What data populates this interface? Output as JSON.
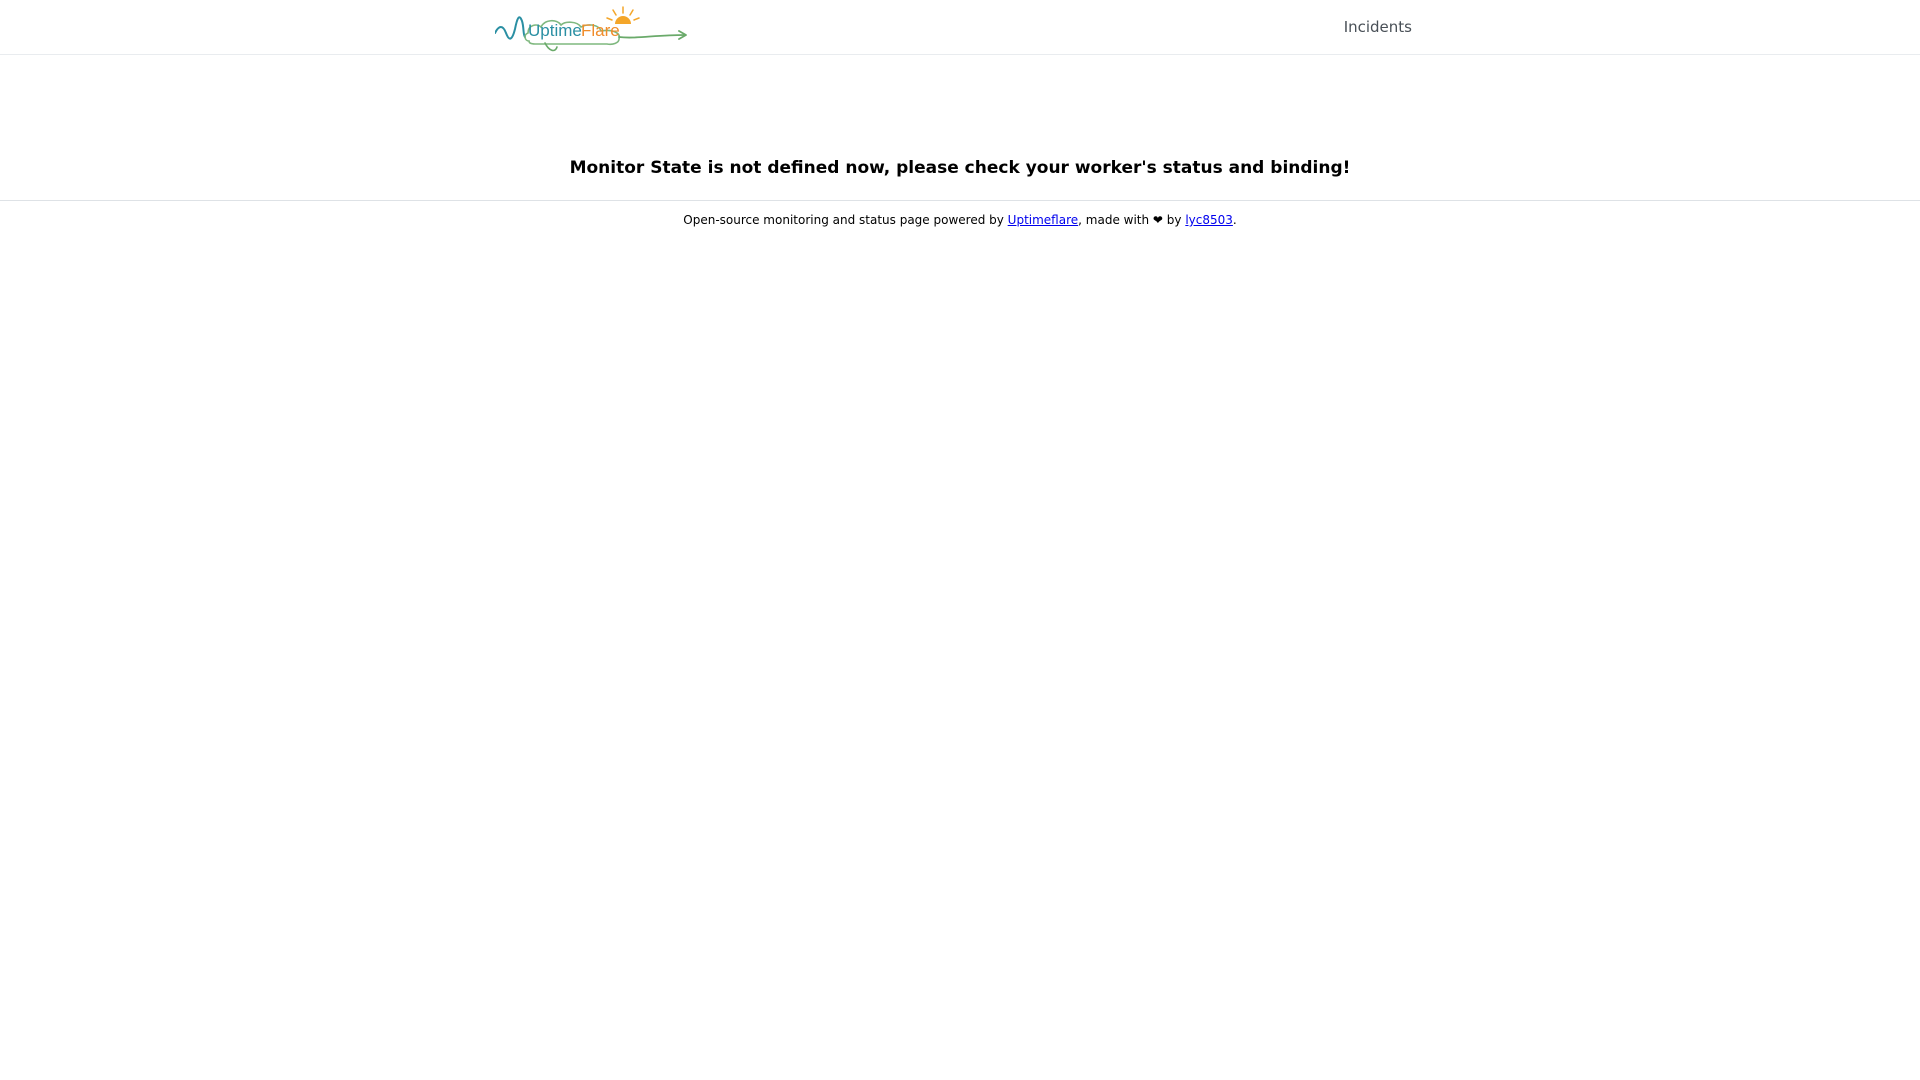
{
  "header": {
    "logo": {
      "text_uptime": "Uptime",
      "text_flare": "Flare",
      "colors": {
        "uptime": "#2a8fa3",
        "flare": "#f08c2a",
        "line": "#6aaa6a",
        "cloud": "#7fb87f",
        "sun": "#f4a62a"
      }
    },
    "nav": {
      "incidents_label": "Incidents"
    }
  },
  "main": {
    "error_message": "Monitor State is not defined now, please check your worker's status and binding!"
  },
  "footer": {
    "prefix": "Open-source monitoring and status page powered by ",
    "uptimeflare_link": "Uptimeflare",
    "middle": ", made with ❤ by ",
    "author_link": "lyc8503",
    "suffix": "."
  },
  "colors": {
    "link": "#0000ee",
    "nav_text": "#495057",
    "divider": "#dee2e6"
  }
}
